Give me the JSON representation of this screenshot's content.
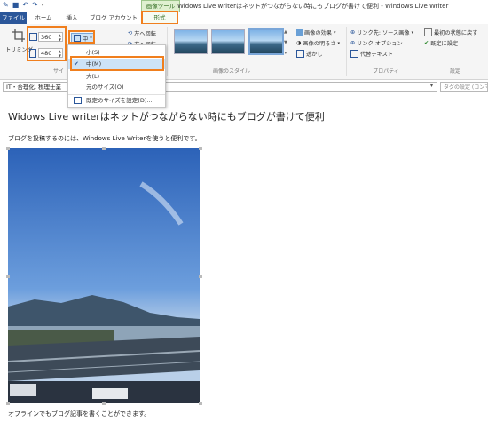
{
  "window": {
    "title": "Widows Live writerはネットがつながらない時にもブログが書けて便利 - Windows Live Writer",
    "context_group": "画像ツール"
  },
  "tabs": [
    "ファイル",
    "ホーム",
    "挿入",
    "ブログ アカウント",
    "形式"
  ],
  "ribbon": {
    "trim_label": "トリミング",
    "size_group_label": "サイ",
    "width_value": "360",
    "height_value": "480",
    "size_preset_label": "中",
    "rotate_left": "左へ回転",
    "rotate_right": "右へ回転",
    "styles_group_label": "画像のスタイル",
    "effects": "画像の効果",
    "brightness": "画像の明るさ",
    "watermark": "透かし",
    "link_source": "リンク先: ソース画像",
    "link_options": "リンク オプション",
    "alt_text": "代替テキスト",
    "properties_group_label": "プロパティ",
    "reset": "最初の状態に戻す",
    "set_default": "既定に設定",
    "settings_group_label": "設定"
  },
  "dropdown": {
    "items": [
      "小(S)",
      "中(M)",
      "大(L)",
      "元のサイズ(O)",
      "既定のサイズを設定(D)..."
    ],
    "checked": "中(M)"
  },
  "category_bar": {
    "category": "IT・合理化, 税理士業",
    "tags_placeholder": "タグの設定 (コンマ"
  },
  "post": {
    "title": "Widows Live writerはネットがつながらない時にもブログが書けて便利",
    "line1": "ブログを投稿するのには、Windows Live Writerを使うと便利です。",
    "line2": "オフラインでもブログ記事を書くことができます。"
  },
  "colors": {
    "accent": "#2b579a",
    "highlight": "#f07f1e",
    "context": "#2f6b1f"
  }
}
